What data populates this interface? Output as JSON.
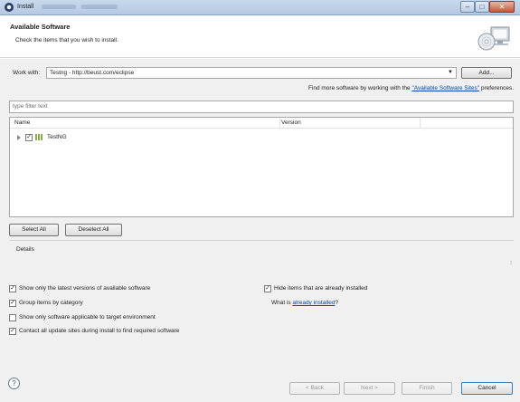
{
  "window": {
    "title": "Install"
  },
  "header": {
    "title": "Available Software",
    "subtitle": "Check the items that you wish to install."
  },
  "work_with": {
    "label": "Work with:",
    "value": "Testng - http://beust.com/eclipse",
    "add_label": "Add..."
  },
  "find_more": {
    "prefix": "Find more software by working with the ",
    "link": "\"Available Software Sites\"",
    "suffix": " preferences."
  },
  "filter": {
    "placeholder": "type filter text"
  },
  "tree": {
    "columns": [
      "Name",
      "Version"
    ],
    "rows": [
      {
        "name": "TestNG",
        "checked": true,
        "version": ""
      }
    ]
  },
  "selection_buttons": {
    "select_all": "Select All",
    "deselect_all": "Deselect All"
  },
  "details": {
    "label": "Details",
    "scroll_glyph": "⁝"
  },
  "options": {
    "latest_only": {
      "label": "Show only the latest versions of available software",
      "checked": true
    },
    "group_by_category": {
      "label": "Group items by category",
      "checked": true
    },
    "target_env_only": {
      "label": "Show only software applicable to target environment",
      "checked": false
    },
    "contact_all_sites": {
      "label": "Contact all update sites during install to find required software",
      "checked": true
    },
    "hide_installed": {
      "label": "Hide items that are already installed",
      "checked": true
    },
    "what_is": {
      "prefix": "What is ",
      "link": "already installed",
      "suffix": "?"
    }
  },
  "footer": {
    "help_glyph": "?",
    "back": "< Back",
    "next": "Next >",
    "finish": "Finish",
    "cancel": "Cancel"
  },
  "colors": {
    "link": "#0645ad",
    "dialog_bg": "#f0f0f0",
    "titlebar": "#b5c9e2"
  }
}
